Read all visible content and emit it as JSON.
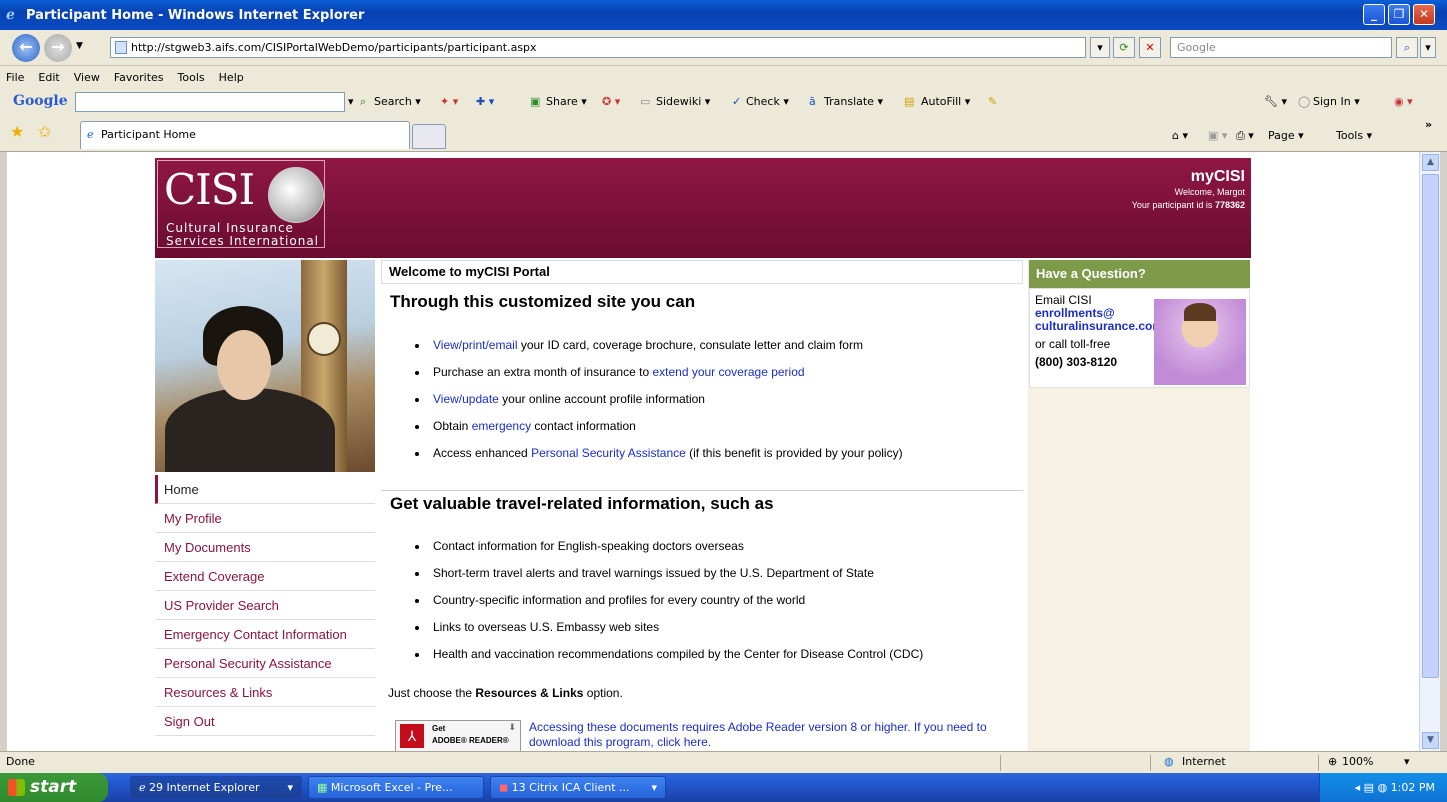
{
  "window": {
    "title": "Participant Home - Windows Internet Explorer"
  },
  "address": {
    "url": "http://stgweb3.aifs.com/CISIPortalWebDemo/participants/participant.aspx",
    "search_placeholder": "Google"
  },
  "menu": [
    "File",
    "Edit",
    "View",
    "Favorites",
    "Tools",
    "Help"
  ],
  "google_toolbar": {
    "logo": "Google",
    "items": [
      "Search ▾",
      "Share ▾",
      "Sidewiki ▾",
      "Check ▾",
      "Translate ▾",
      "AutoFill ▾"
    ],
    "sign_in": "Sign In ▾"
  },
  "tabs": {
    "active": "Participant Home",
    "tools": [
      "Page ▾",
      "Tools ▾"
    ]
  },
  "site": {
    "logo": {
      "mark": "CISI",
      "line1": "Cultural Insurance",
      "line2": "Services International"
    },
    "header": {
      "brand": "myCISI",
      "welcome": "Welcome, Margot",
      "id_prefix": "Your participant id is",
      "id": "778362"
    },
    "nav": [
      "Home",
      "My Profile",
      "My Documents",
      "Extend Coverage",
      "US Provider Search",
      "Emergency Contact Information",
      "Personal Security Assistance",
      "Resources & Links",
      "Sign Out"
    ],
    "main": {
      "welcome": "Welcome to myCISI Portal",
      "heading1": "Through this customized site you can",
      "list1": [
        {
          "link": "View/print/email",
          "text": " your ID card, coverage brochure, consulate letter and claim form"
        },
        {
          "pre": "Purchase an extra month of insurance to ",
          "link": "extend your coverage period"
        },
        {
          "link": "View/update",
          "text": " your online account profile information"
        },
        {
          "pre": "Obtain ",
          "link": "emergency",
          "text": " contact information"
        },
        {
          "pre": "Access enhanced ",
          "link": "Personal Security Assistance",
          "text": " (if this benefit is provided by your policy)"
        }
      ],
      "heading2": "Get valuable travel-related information, such as",
      "list2": [
        "Contact information for English-speaking doctors overseas",
        "Short-term travel alerts and travel warnings issued by the U.S. Department of State",
        "Country-specific information and profiles for every country of the world",
        "Links to overseas U.S. Embassy web sites",
        "Health and vaccination recommendations compiled by the Center for Disease Control (CDC)"
      ],
      "choose_pre": "Just choose the ",
      "choose_bold": "Resources & Links",
      "choose_post": " option.",
      "adobe_get": "Get",
      "adobe_reader": "ADOBE® READER®",
      "adobe_text": "Accessing these documents requires Adobe Reader version 8 or higher. If you need to download this program, click here."
    },
    "sidebar": {
      "title": "Have a Question?",
      "email_label": "Email CISI",
      "email1": "enrollments@",
      "email2": "culturalinsurance.com",
      "call": "or call toll-free",
      "phone": "(800) 303-8120"
    }
  },
  "status": {
    "left": "Done",
    "zone": "Internet",
    "zoom": "100%"
  },
  "taskbar": {
    "start": "start",
    "tasks": [
      "29 Internet Explorer",
      "Microsoft Excel - Pre...",
      "13 Citrix ICA Client ..."
    ],
    "time": "1:02 PM"
  }
}
